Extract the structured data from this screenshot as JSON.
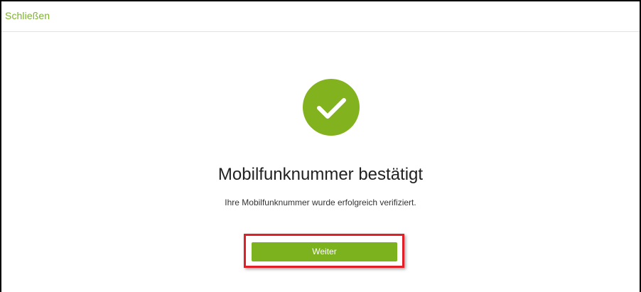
{
  "header": {
    "close_label": "Schließen"
  },
  "status": {
    "icon": "checkmark-circle-icon",
    "title": "Mobilfunknummer bestätigt",
    "message": "Ihre Mobilfunknummer wurde erfolgreich verifiziert."
  },
  "actions": {
    "continue_label": "Weiter"
  },
  "colors": {
    "accent": "#7cb21e",
    "link": "#7db32b",
    "highlight": "#e01f26"
  }
}
